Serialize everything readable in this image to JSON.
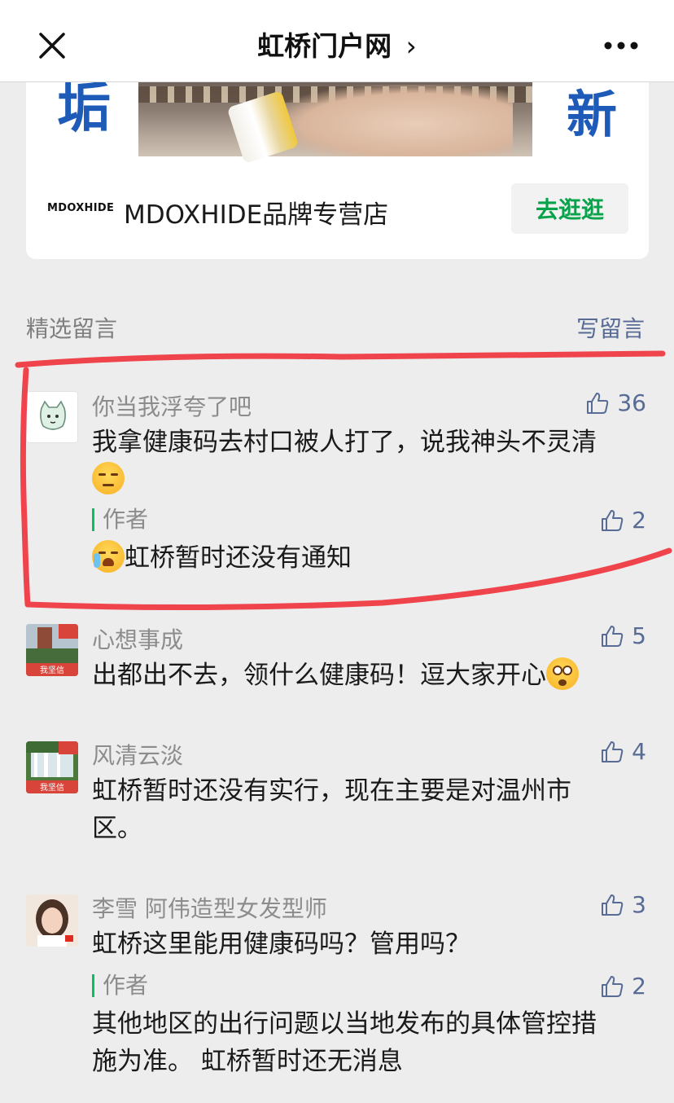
{
  "nav": {
    "title": "虹桥门户网",
    "chevron": "›",
    "close_icon": "close-icon",
    "more_icon": "more-icon"
  },
  "ad": {
    "left_char": "垢",
    "right_char": "新",
    "brand_logo": "MDOXHIDE",
    "brand_name": "MDOXHIDE品牌专营店",
    "button_label": "去逛逛"
  },
  "section": {
    "title": "精选留言",
    "write_label": "写留言"
  },
  "comments": [
    {
      "nickname": "你当我浮夸了吧",
      "likes": "36",
      "text": "我拿健康码去村口被人打了，说我神头不灵清",
      "emoji": "unamused-emoji",
      "reply": {
        "label": "作者",
        "likes": "2",
        "emoji": "crying-emoji",
        "text": "虹桥暂时还没有通知"
      }
    },
    {
      "nickname": "心想事成",
      "likes": "5",
      "text": "出都出不去，领什么健康码！逗大家开心",
      "emoji": "dizzy-emoji",
      "avatar_badge": "我坚信"
    },
    {
      "nickname": "风清云淡",
      "likes": "4",
      "text_line1": "虹桥暂时还没有实行，现在主要是对温州市",
      "text_line2": "区。",
      "avatar_badge": "我坚信"
    },
    {
      "nickname": "李雪 阿伟造型女发型师",
      "likes": "3",
      "text": "虹桥这里能用健康码吗？管用吗？",
      "reply": {
        "label": "作者",
        "likes": "2",
        "text_line1": "其他地区的出行问题以当地发布的具体管控措",
        "text_line2": "施为准。 虹桥暂时还无消息"
      }
    }
  ],
  "colors": {
    "link": "#576b95",
    "green": "#07a34a",
    "highlight": "#f0444c"
  }
}
